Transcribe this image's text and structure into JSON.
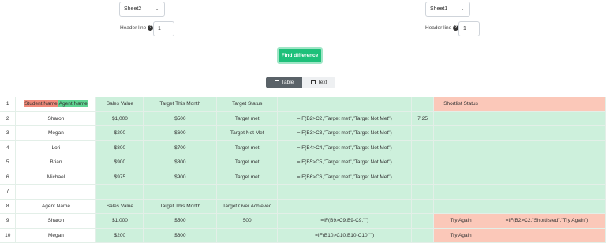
{
  "left": {
    "sheet": "Sheet2",
    "header_label": "Header line",
    "header_value": "1"
  },
  "right": {
    "sheet": "Sheet1",
    "header_label": "Header line",
    "header_value": "1"
  },
  "find_button": "Find difference",
  "view_toggle": {
    "table": "Table",
    "text": "Text"
  },
  "rows": [
    {
      "n": "1",
      "c": [
        "",
        "Sales Value",
        "Target This Month",
        "Target Status",
        "",
        "",
        "Shortlist Status",
        ""
      ]
    },
    {
      "n": "2",
      "c": [
        "Sharon",
        "$1,000",
        "$500",
        "Target met",
        "=IF(B2>C2,\"Target met\",\"Target Not Met\")",
        "7.25",
        "",
        ""
      ]
    },
    {
      "n": "3",
      "c": [
        "Megan",
        "$200",
        "$600",
        "Target Not Met",
        "=IF(B3>C3,\"Target met\",\"Target Not Met\")",
        "",
        "",
        ""
      ]
    },
    {
      "n": "4",
      "c": [
        "Lori",
        "$800",
        "$700",
        "Target met",
        "=IF(B4>C4,\"Target met\",\"Target Not Met\")",
        "",
        "",
        ""
      ]
    },
    {
      "n": "5",
      "c": [
        "Brian",
        "$900",
        "$800",
        "Target met",
        "=IF(B5>C5,\"Target met\",\"Target Not Met\")",
        "",
        "",
        ""
      ]
    },
    {
      "n": "6",
      "c": [
        "Michael",
        "$975",
        "$900",
        "Target met",
        "=IF(B6>C6,\"Target met\",\"Target Not Met\")",
        "",
        "",
        ""
      ]
    },
    {
      "n": "7",
      "c": [
        "",
        "",
        "",
        "",
        "",
        "",
        "",
        ""
      ]
    },
    {
      "n": "8",
      "c": [
        "Agent Name",
        "Sales Value",
        "Target This Month",
        "Target Over Achieved",
        "",
        "",
        "",
        ""
      ]
    },
    {
      "n": "9",
      "c": [
        "Sharon",
        "$1,000",
        "$500",
        "500",
        "=IF(B9>C9,B9-C9,\"\")",
        "",
        "Try Again",
        "=IF(B2>C2,\"Shortlisted\",\"Try Again\")"
      ]
    },
    {
      "n": "10",
      "c": [
        "Megan",
        "$200",
        "$600",
        "",
        "=IF(B10>C10,B10-C10,\"\")",
        "",
        "Try Again",
        ""
      ]
    }
  ],
  "row1_cell_a": {
    "removed": "Student Name",
    "added": "Agent Name"
  },
  "colors": {
    "added_bg": "#cdf0dc",
    "changed_bg": "#fbc8b9",
    "button": "#1ec07a"
  }
}
